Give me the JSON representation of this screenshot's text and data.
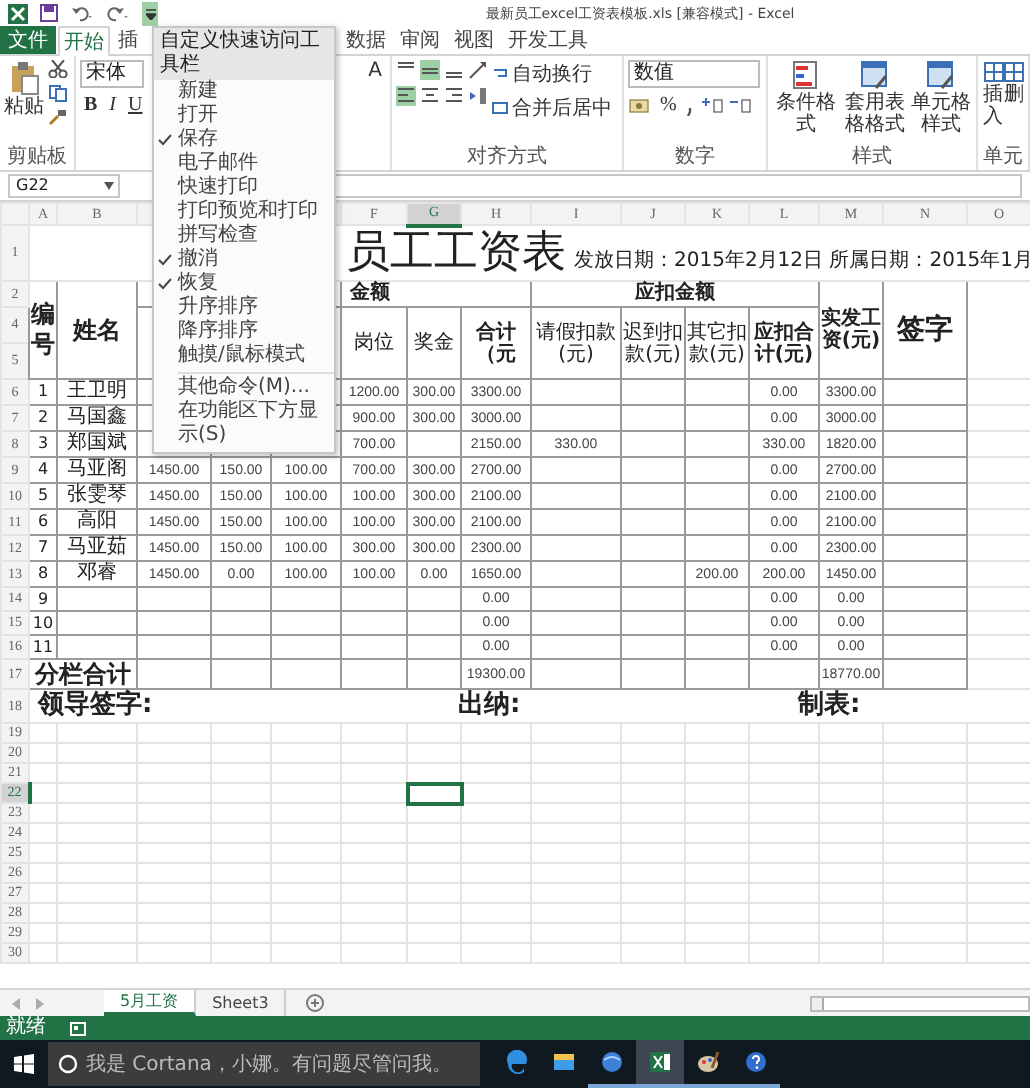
{
  "window": {
    "title": "最新员工excel工资表模板.xls  [兼容模式] - Excel"
  },
  "ribbon_tabs": [
    {
      "label": "文件",
      "kind": "file",
      "selected": false
    },
    {
      "label": "开始",
      "kind": "tab",
      "selected": true
    },
    {
      "label": "插",
      "kind": "tab",
      "selected": false
    },
    {
      "label": "数据",
      "kind": "tab",
      "selected": false
    },
    {
      "label": "审阅",
      "kind": "tab",
      "selected": false
    },
    {
      "label": "视图",
      "kind": "tab",
      "selected": false
    },
    {
      "label": "开发工具",
      "kind": "tab",
      "selected": false
    }
  ],
  "ribbon": {
    "clipboard": {
      "paste": "粘贴",
      "label": "剪贴板"
    },
    "font": {
      "name": "宋体",
      "buttons": [
        "B",
        "I",
        "U"
      ],
      "size_button": "A"
    },
    "alignment": {
      "wrap": "自动换行",
      "merge": "合并后居中",
      "label": "对齐方式"
    },
    "number": {
      "format": "数值",
      "percent": "%",
      "label": "数字"
    },
    "styles": {
      "buttons": [
        "条件格式",
        "套用表格格式",
        "单元格样式"
      ],
      "label": "样式"
    },
    "cells": {
      "buttons": [
        "插入",
        "删"
      ],
      "label": "单元"
    }
  },
  "quick_access_menu": {
    "title": "自定义快速访问工具栏",
    "items": [
      {
        "label": "新建",
        "checked": false
      },
      {
        "label": "打开",
        "checked": false
      },
      {
        "label": "保存",
        "checked": true
      },
      {
        "label": "电子邮件",
        "checked": false
      },
      {
        "label": "快速打印",
        "checked": false
      },
      {
        "label": "打印预览和打印",
        "checked": false
      },
      {
        "label": "拼写检查",
        "checked": false
      },
      {
        "label": "撤消",
        "checked": true
      },
      {
        "label": "恢复",
        "checked": true
      },
      {
        "label": "升序排序",
        "checked": false
      },
      {
        "label": "降序排序",
        "checked": false
      },
      {
        "label": "触摸/鼠标模式",
        "checked": false
      }
    ],
    "more_items": [
      "其他命令(M)...",
      "在功能区下方显示(S)"
    ]
  },
  "name_box": "G22",
  "columns": {
    "left": [
      {
        "label": "A",
        "selected": false
      },
      {
        "label": "B",
        "selected": false
      }
    ],
    "right": [
      {
        "label": "F",
        "selected": false
      },
      {
        "label": "G",
        "selected": true
      },
      {
        "label": "H",
        "selected": false
      },
      {
        "label": "I",
        "selected": false
      },
      {
        "label": "J",
        "selected": false
      },
      {
        "label": "K",
        "selected": false
      },
      {
        "label": "L",
        "selected": false
      },
      {
        "label": "M",
        "selected": false
      },
      {
        "label": "N",
        "selected": false
      },
      {
        "label": "O",
        "selected": false
      }
    ]
  },
  "sheet": {
    "title": {
      "number": "1",
      "text": "员工工资表",
      "subtitle": "发放日期：2015年2月12日 所属日期：2015年1月"
    },
    "header": {
      "numbers": [
        "2",
        "4",
        "5"
      ],
      "number_label": "编号",
      "name_label": "姓名",
      "group_labels": [
        "金额",
        "应扣金额"
      ],
      "column_labels": [
        "岗位",
        "奖金",
        "合计（元",
        "请假扣款(元)",
        "迟到扣款(元)",
        "其它扣款(元)",
        "应扣合计(元)"
      ],
      "net_label": "实发工资(元)",
      "sign_label": "签字"
    },
    "rows": [
      {
        "number": "6",
        "no": "1",
        "name": "王卫明",
        "cells": {
          "F": "1200.00",
          "G": "300.00",
          "H": "3300.00",
          "L": "0.00",
          "M": "3300.00"
        }
      },
      {
        "number": "7",
        "no": "2",
        "name": "马国鑫",
        "cells": {
          "F": "900.00",
          "G": "300.00",
          "H": "3000.00",
          "L": "0.00",
          "M": "3000.00"
        }
      },
      {
        "number": "8",
        "no": "3",
        "name": "郑国斌",
        "cells": {
          "F": "700.00",
          "H": "2150.00",
          "I": "330.00",
          "L": "330.00",
          "M": "1820.00"
        }
      },
      {
        "number": "9",
        "no": "4",
        "name": "马亚阁",
        "cells": {
          "C": "1450.00",
          "D": "150.00",
          "E": "100.00",
          "F": "700.00",
          "G": "300.00",
          "H": "2700.00",
          "L": "0.00",
          "M": "2700.00"
        }
      },
      {
        "number": "10",
        "no": "5",
        "name": "张雯琴",
        "cells": {
          "C": "1450.00",
          "D": "150.00",
          "E": "100.00",
          "F": "100.00",
          "G": "300.00",
          "H": "2100.00",
          "L": "0.00",
          "M": "2100.00"
        }
      },
      {
        "number": "11",
        "no": "6",
        "name": "高阳",
        "cells": {
          "C": "1450.00",
          "D": "150.00",
          "E": "100.00",
          "F": "100.00",
          "G": "300.00",
          "H": "2100.00",
          "L": "0.00",
          "M": "2100.00"
        }
      },
      {
        "number": "12",
        "no": "7",
        "name": "马亚茹",
        "cells": {
          "C": "1450.00",
          "D": "150.00",
          "E": "100.00",
          "F": "300.00",
          "G": "300.00",
          "H": "2300.00",
          "L": "0.00",
          "M": "2300.00"
        }
      },
      {
        "number": "13",
        "no": "8",
        "name": "邓睿",
        "cells": {
          "C": "1450.00",
          "D": "0.00",
          "E": "100.00",
          "F": "100.00",
          "G": "0.00",
          "H": "1650.00",
          "K": "200.00",
          "L": "200.00",
          "M": "1450.00"
        }
      },
      {
        "number": "14",
        "no": "9",
        "cells": {
          "H": "0.00",
          "L": "0.00",
          "M": "0.00"
        }
      },
      {
        "number": "15",
        "no": "10",
        "cells": {
          "H": "0.00",
          "L": "0.00",
          "M": "0.00"
        }
      },
      {
        "number": "16",
        "no": "11",
        "cells": {
          "H": "0.00",
          "L": "0.00",
          "M": "0.00"
        }
      }
    ],
    "total": {
      "number": "17",
      "label": "分栏合计",
      "total": "19300.00",
      "net_total": "18770.00"
    },
    "signatures": {
      "number": "18",
      "labels": [
        "领导签字:",
        "出纳:",
        "制表:"
      ]
    },
    "blank_rows": [
      {
        "number": "19",
        "selected": false
      },
      {
        "number": "20",
        "selected": false
      },
      {
        "number": "21",
        "selected": false
      },
      {
        "number": "22",
        "selected": true
      },
      {
        "number": "23",
        "selected": false
      },
      {
        "number": "24",
        "selected": false
      },
      {
        "number": "25",
        "selected": false
      },
      {
        "number": "26",
        "selected": false
      },
      {
        "number": "27",
        "selected": false
      },
      {
        "number": "28",
        "selected": false
      },
      {
        "number": "29",
        "selected": false
      },
      {
        "number": "30",
        "selected": false
      }
    ]
  },
  "sheet_tabs": [
    {
      "label": "5月工资",
      "selected": true
    },
    {
      "label": "Sheet3",
      "selected": false
    }
  ],
  "status_bar": {
    "text": "就绪"
  },
  "taskbar": {
    "search": {
      "placeholder": "我是 Cortana，小娜。有问题尽管问我。"
    },
    "apps": [
      {
        "kind": "edge",
        "running": false,
        "active": false
      },
      {
        "kind": "explorer",
        "running": false,
        "active": false
      },
      {
        "kind": "globe",
        "running": true,
        "active": false
      },
      {
        "kind": "excel",
        "running": true,
        "active": true
      },
      {
        "kind": "paint",
        "running": true,
        "active": false
      },
      {
        "kind": "help",
        "running": true,
        "active": false
      }
    ]
  }
}
